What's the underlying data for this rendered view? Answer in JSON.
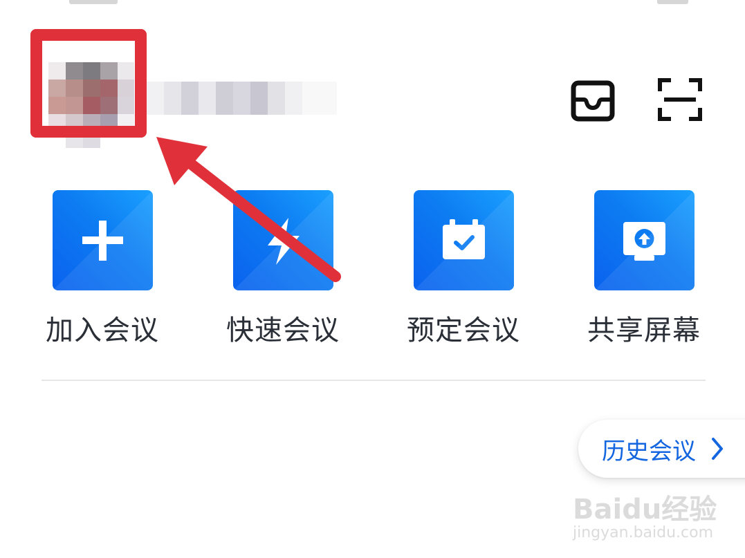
{
  "user": {
    "name_redacted": true
  },
  "header_icons": {
    "inbox": "inbox-icon",
    "scan": "scan-icon"
  },
  "actions": [
    {
      "label": "加入会议",
      "icon": "plus-icon"
    },
    {
      "label": "快速会议",
      "icon": "lightning-icon"
    },
    {
      "label": "预定会议",
      "icon": "calendar-check-icon"
    },
    {
      "label": "共享屏幕",
      "icon": "share-screen-icon"
    }
  ],
  "history": {
    "label": "历史会议",
    "icon": "chevron-right-icon"
  },
  "annotation": {
    "color": "#e0313b"
  },
  "watermark": {
    "brand": "Baidu经验",
    "url": "jingyan.baidu.com"
  },
  "colors": {
    "accent": "#0d7cf2",
    "link": "#1466e0"
  }
}
